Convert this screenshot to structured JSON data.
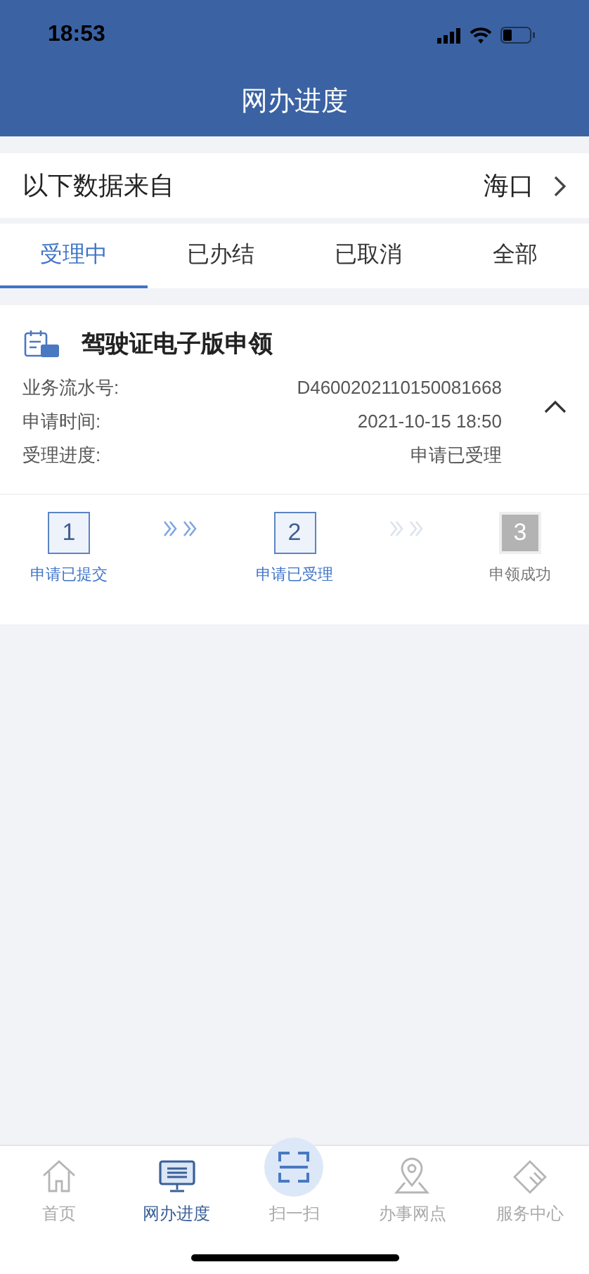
{
  "status_bar": {
    "time": "18:53"
  },
  "title": "网办进度",
  "source": {
    "label": "以下数据来自",
    "value": "海口"
  },
  "tabs": [
    {
      "label": "受理中",
      "selected": true
    },
    {
      "label": "已办结",
      "selected": false
    },
    {
      "label": "已取消",
      "selected": false
    },
    {
      "label": "全部",
      "selected": false
    }
  ],
  "record": {
    "title": "驾驶证电子版申领",
    "expanded": true,
    "fields": [
      {
        "label": "业务流水号:",
        "value": "D4600202110150081668"
      },
      {
        "label": "申请时间:",
        "value": "2021-10-15 18:50"
      },
      {
        "label": "受理进度:",
        "value": "申请已受理"
      }
    ],
    "steps": [
      {
        "number": "1",
        "label": "申请已提交",
        "done": true
      },
      {
        "number": "2",
        "label": "申请已受理",
        "done": true
      },
      {
        "number": "3",
        "label": "申领成功",
        "done": false
      }
    ]
  },
  "nav": [
    {
      "label": "首页",
      "kind": "flat",
      "selected": false
    },
    {
      "label": "网办进度",
      "kind": "flat",
      "selected": true
    },
    {
      "label": "扫一扫",
      "kind": "raised",
      "selected": false
    },
    {
      "label": "办事网点",
      "kind": "flat",
      "selected": false
    },
    {
      "label": "服务中心",
      "kind": "flat",
      "selected": false
    }
  ]
}
